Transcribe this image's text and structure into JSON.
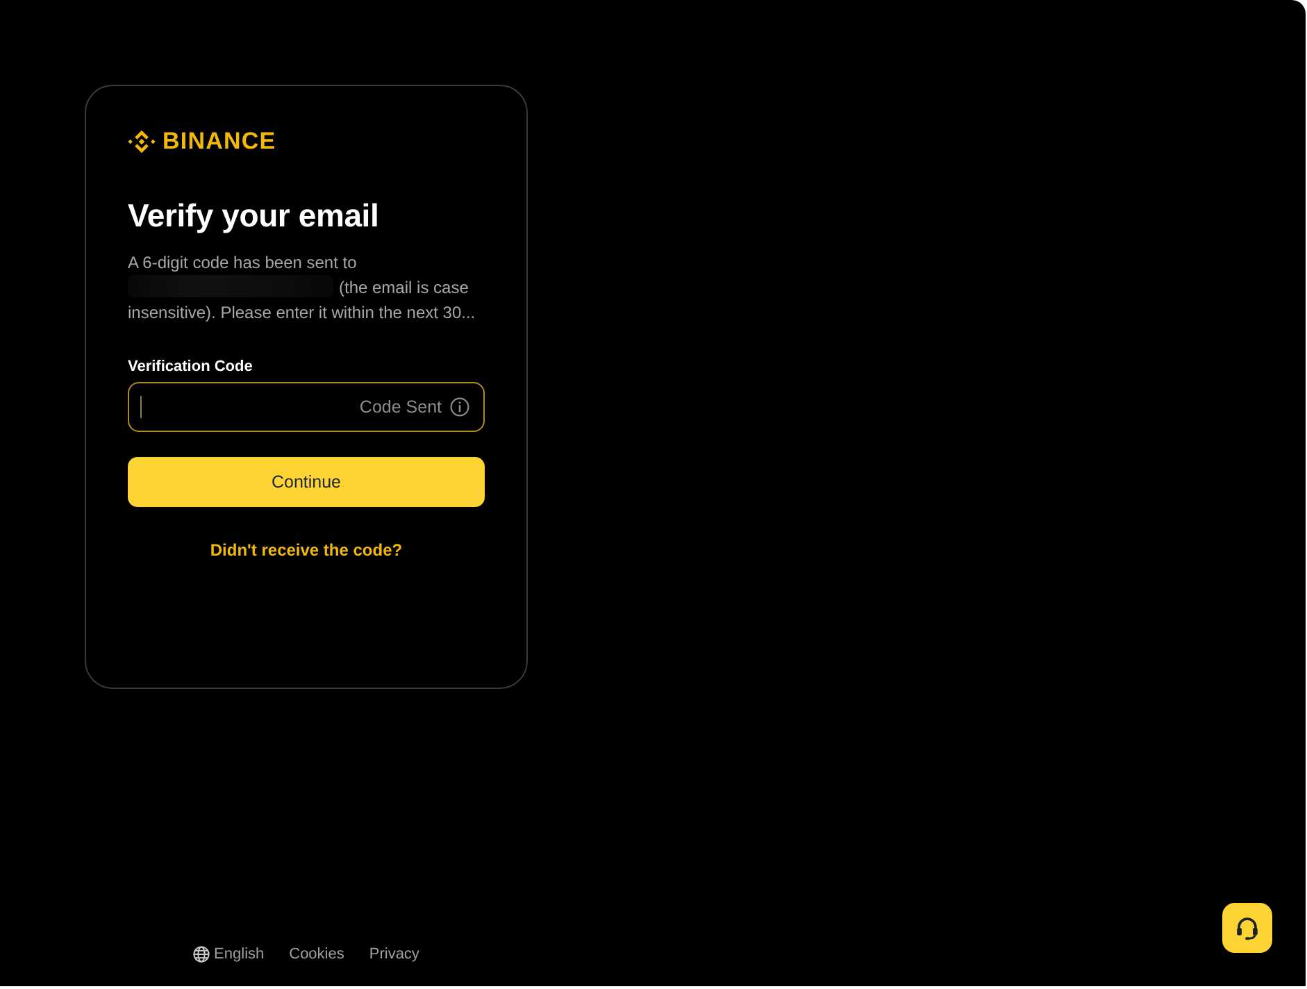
{
  "logo": {
    "text": "BINANCE"
  },
  "title": "Verify your email",
  "description": {
    "before": "A 6-digit code has been sent to",
    "email_redacted": true,
    "after": "(the email is case insensitive). Please enter it within the next 30..."
  },
  "code_field": {
    "label": "Verification Code",
    "focused": true,
    "status": "Code Sent"
  },
  "continue_button": "Continue",
  "resend_link": "Didn't receive the code?",
  "footer": {
    "links": [
      {
        "kind": "language",
        "label": "English"
      },
      {
        "kind": "plain",
        "label": "Cookies"
      },
      {
        "kind": "plain",
        "label": "Privacy"
      }
    ]
  }
}
